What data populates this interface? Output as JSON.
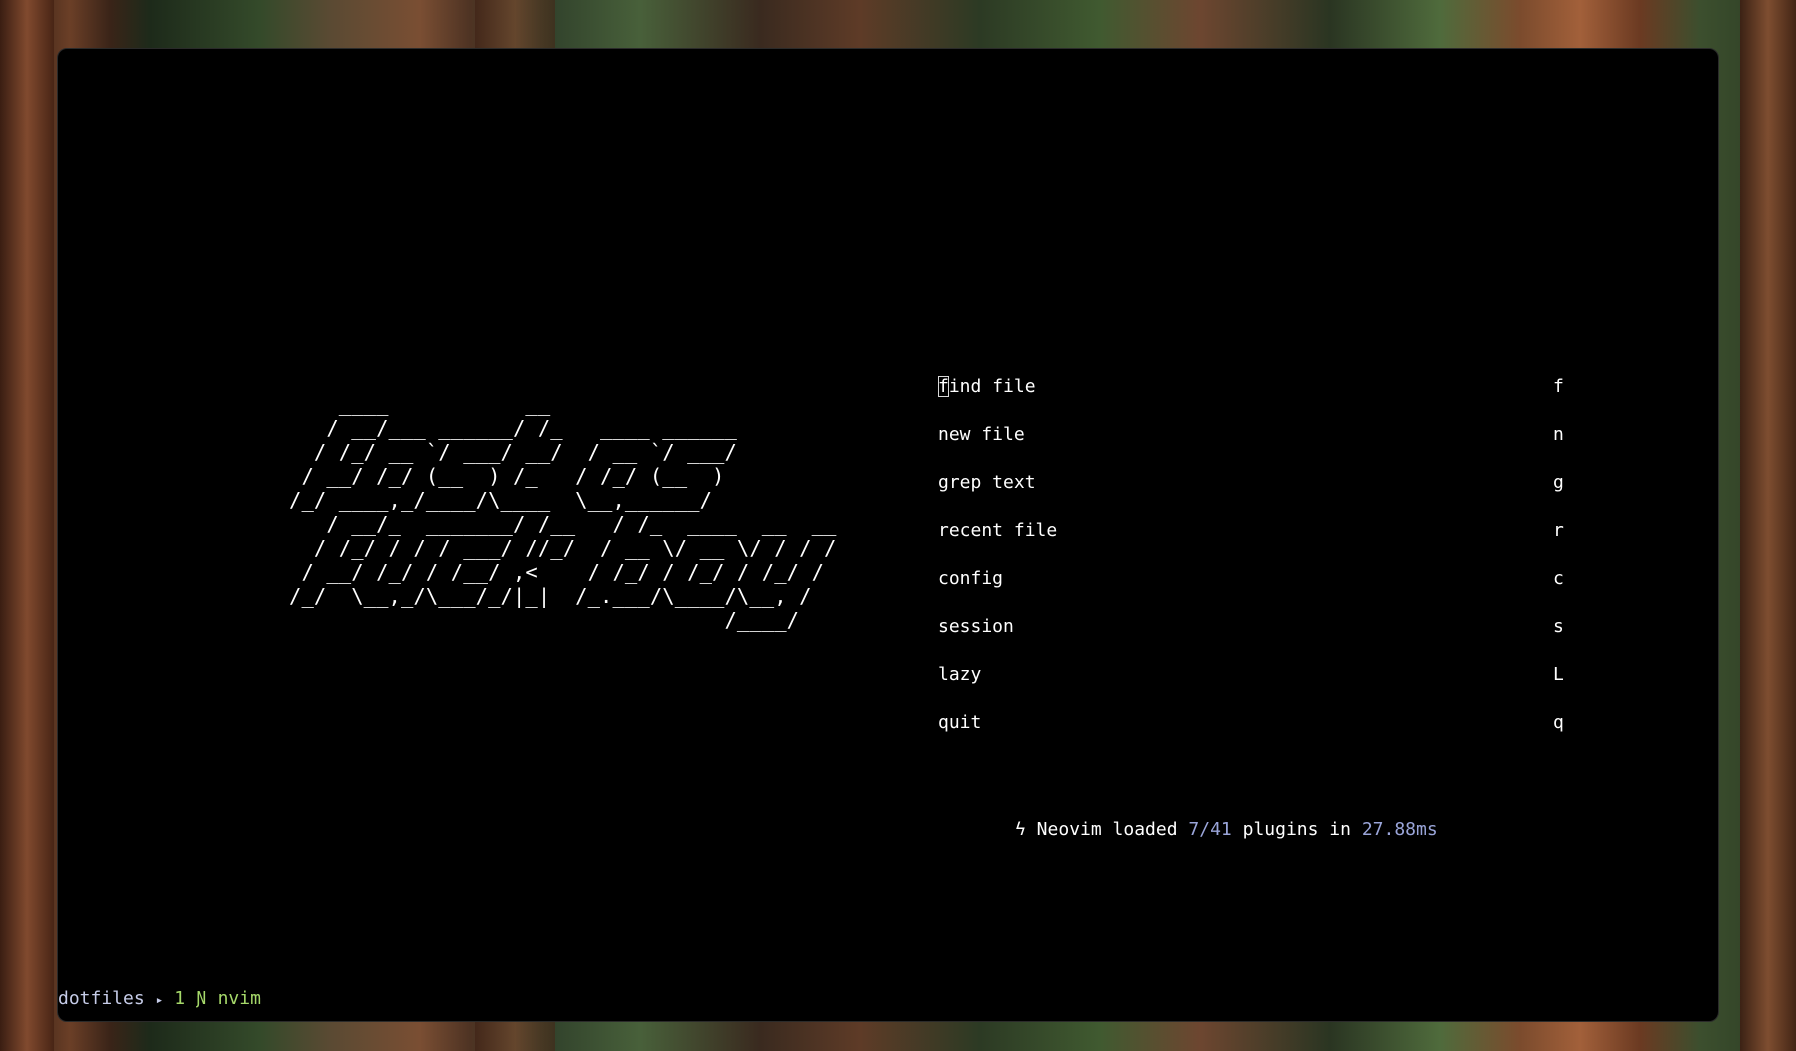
{
  "logo_lines": [
    "    ____           __",
    "   / __/___ ______/ /_   ____ ______",
    "  / /_/ __ `/ ___/ __/  / __ `/ ___/",
    " / __/ /_/ (__  ) /_   / /_/ (__  )",
    "/_/ ____,_/____/\\____  \\__,______/",
    "   / __/_  _______/ /__   / /_  ____  __  __",
    "  / /_/ / / / ___/ //_/  / __ \\/ __ \\/ / / /",
    " / __/ /_/ / /__/ ,<    / /_/ / /_/ / /_/ /",
    "/_/  \\__,_/\\___/_/|_|  /_.___/\\____/\\__, /",
    "                                   /____/"
  ],
  "menu": [
    {
      "label_first": "f",
      "label_rest": "ind file",
      "key": "f"
    },
    {
      "label_first": "",
      "label_rest": "new file",
      "key": "n"
    },
    {
      "label_first": "",
      "label_rest": "grep text",
      "key": "g"
    },
    {
      "label_first": "",
      "label_rest": "recent file",
      "key": "r"
    },
    {
      "label_first": "",
      "label_rest": "config",
      "key": "c"
    },
    {
      "label_first": "",
      "label_rest": "session",
      "key": "s"
    },
    {
      "label_first": "",
      "label_rest": "lazy",
      "key": "L"
    },
    {
      "label_first": "",
      "label_rest": "quit",
      "key": "q"
    }
  ],
  "footer": {
    "icon": "lightning-icon",
    "icon_glyph": "ϟ",
    "text_before": " Neovim loaded ",
    "loaded": "7/41",
    "text_middle": " plugins in ",
    "time": "27.88ms"
  },
  "statusline": {
    "session": "dotfiles",
    "separator": "▸",
    "window_index": "1",
    "app_icon": "neovim-icon",
    "app_glyph": "Ɲ",
    "app_name": "nvim"
  },
  "colors": {
    "highlight": "#9aa5d9",
    "status_green": "#a6d96a",
    "background": "#000000"
  }
}
